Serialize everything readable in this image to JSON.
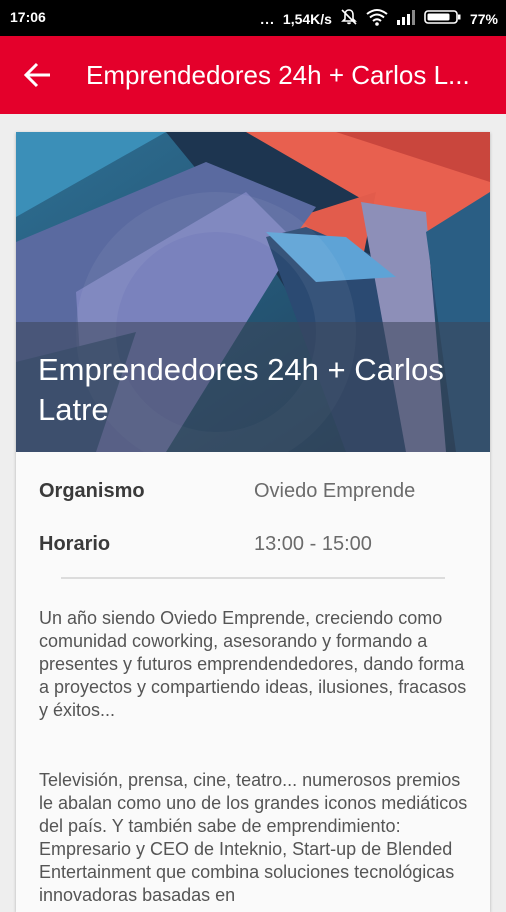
{
  "status_bar": {
    "time": "17:06",
    "dots": "...",
    "network_speed": "1,54K/s",
    "battery": "77%"
  },
  "app_bar": {
    "title": "Emprendedores 24h + Carlos L...",
    "color": "#e4002b"
  },
  "event": {
    "title": "Emprendedores 24h + Carlos Latre",
    "details": [
      {
        "label": "Organismo",
        "value": "Oviedo Emprende"
      },
      {
        "label": "Horario",
        "value": "13:00 - 15:00"
      }
    ],
    "description": [
      "Un año siendo Oviedo Emprende, creciendo como comunidad coworking, asesorando y formando a presentes y futuros emprendendedores, dando forma a proyectos y compartiendo ideas, ilusiones, fracasos y éxitos...",
      "Televisión, prensa, cine, teatro... numerosos premios le abalan como uno de los grandes iconos mediáticos del país. Y también sabe de emprendimiento: Empresario y CEO de Inteknio, Start-up de Blended Entertainment que combina soluciones tecnológicas innovadoras basadas en"
    ]
  }
}
